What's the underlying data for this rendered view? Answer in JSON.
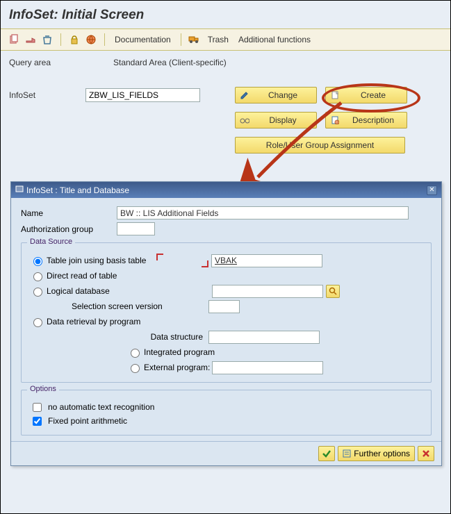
{
  "title": "InfoSet: Initial Screen",
  "toolbar": {
    "documentation": "Documentation",
    "trash": "Trash",
    "additional_functions": "Additional functions"
  },
  "query_area_label": "Query area",
  "query_area_value": "Standard Area (Client-specific)",
  "infoset_label": "InfoSet",
  "infoset_value": "ZBW_LIS_FIELDS",
  "buttons": {
    "change": "Change",
    "create": "Create",
    "display": "Display",
    "description": "Description",
    "role_assignment": "Role/User Group Assignment"
  },
  "dialog": {
    "title": "InfoSet  : Title and Database",
    "name_label": "Name",
    "name_value": "BW :: LIS Additional Fields",
    "authgroup_label": "Authorization group",
    "authgroup_value": "",
    "datasource": {
      "legend": "Data Source",
      "opt_table_join": "Table join using basis table",
      "opt_table_join_val": "VBAK",
      "opt_direct_read": "Direct read of table",
      "opt_logical_db": "Logical database",
      "sel_screen_label": "Selection screen version",
      "opt_data_retrieval": "Data retrieval by program",
      "data_structure_label": "Data structure",
      "opt_integrated": "Integrated program",
      "opt_external": "External program:"
    },
    "options": {
      "legend": "Options",
      "no_auto_text": "no automatic text recognition",
      "fixed_point": "Fixed point arithmetic"
    },
    "footer": {
      "further_options": "Further options"
    }
  }
}
